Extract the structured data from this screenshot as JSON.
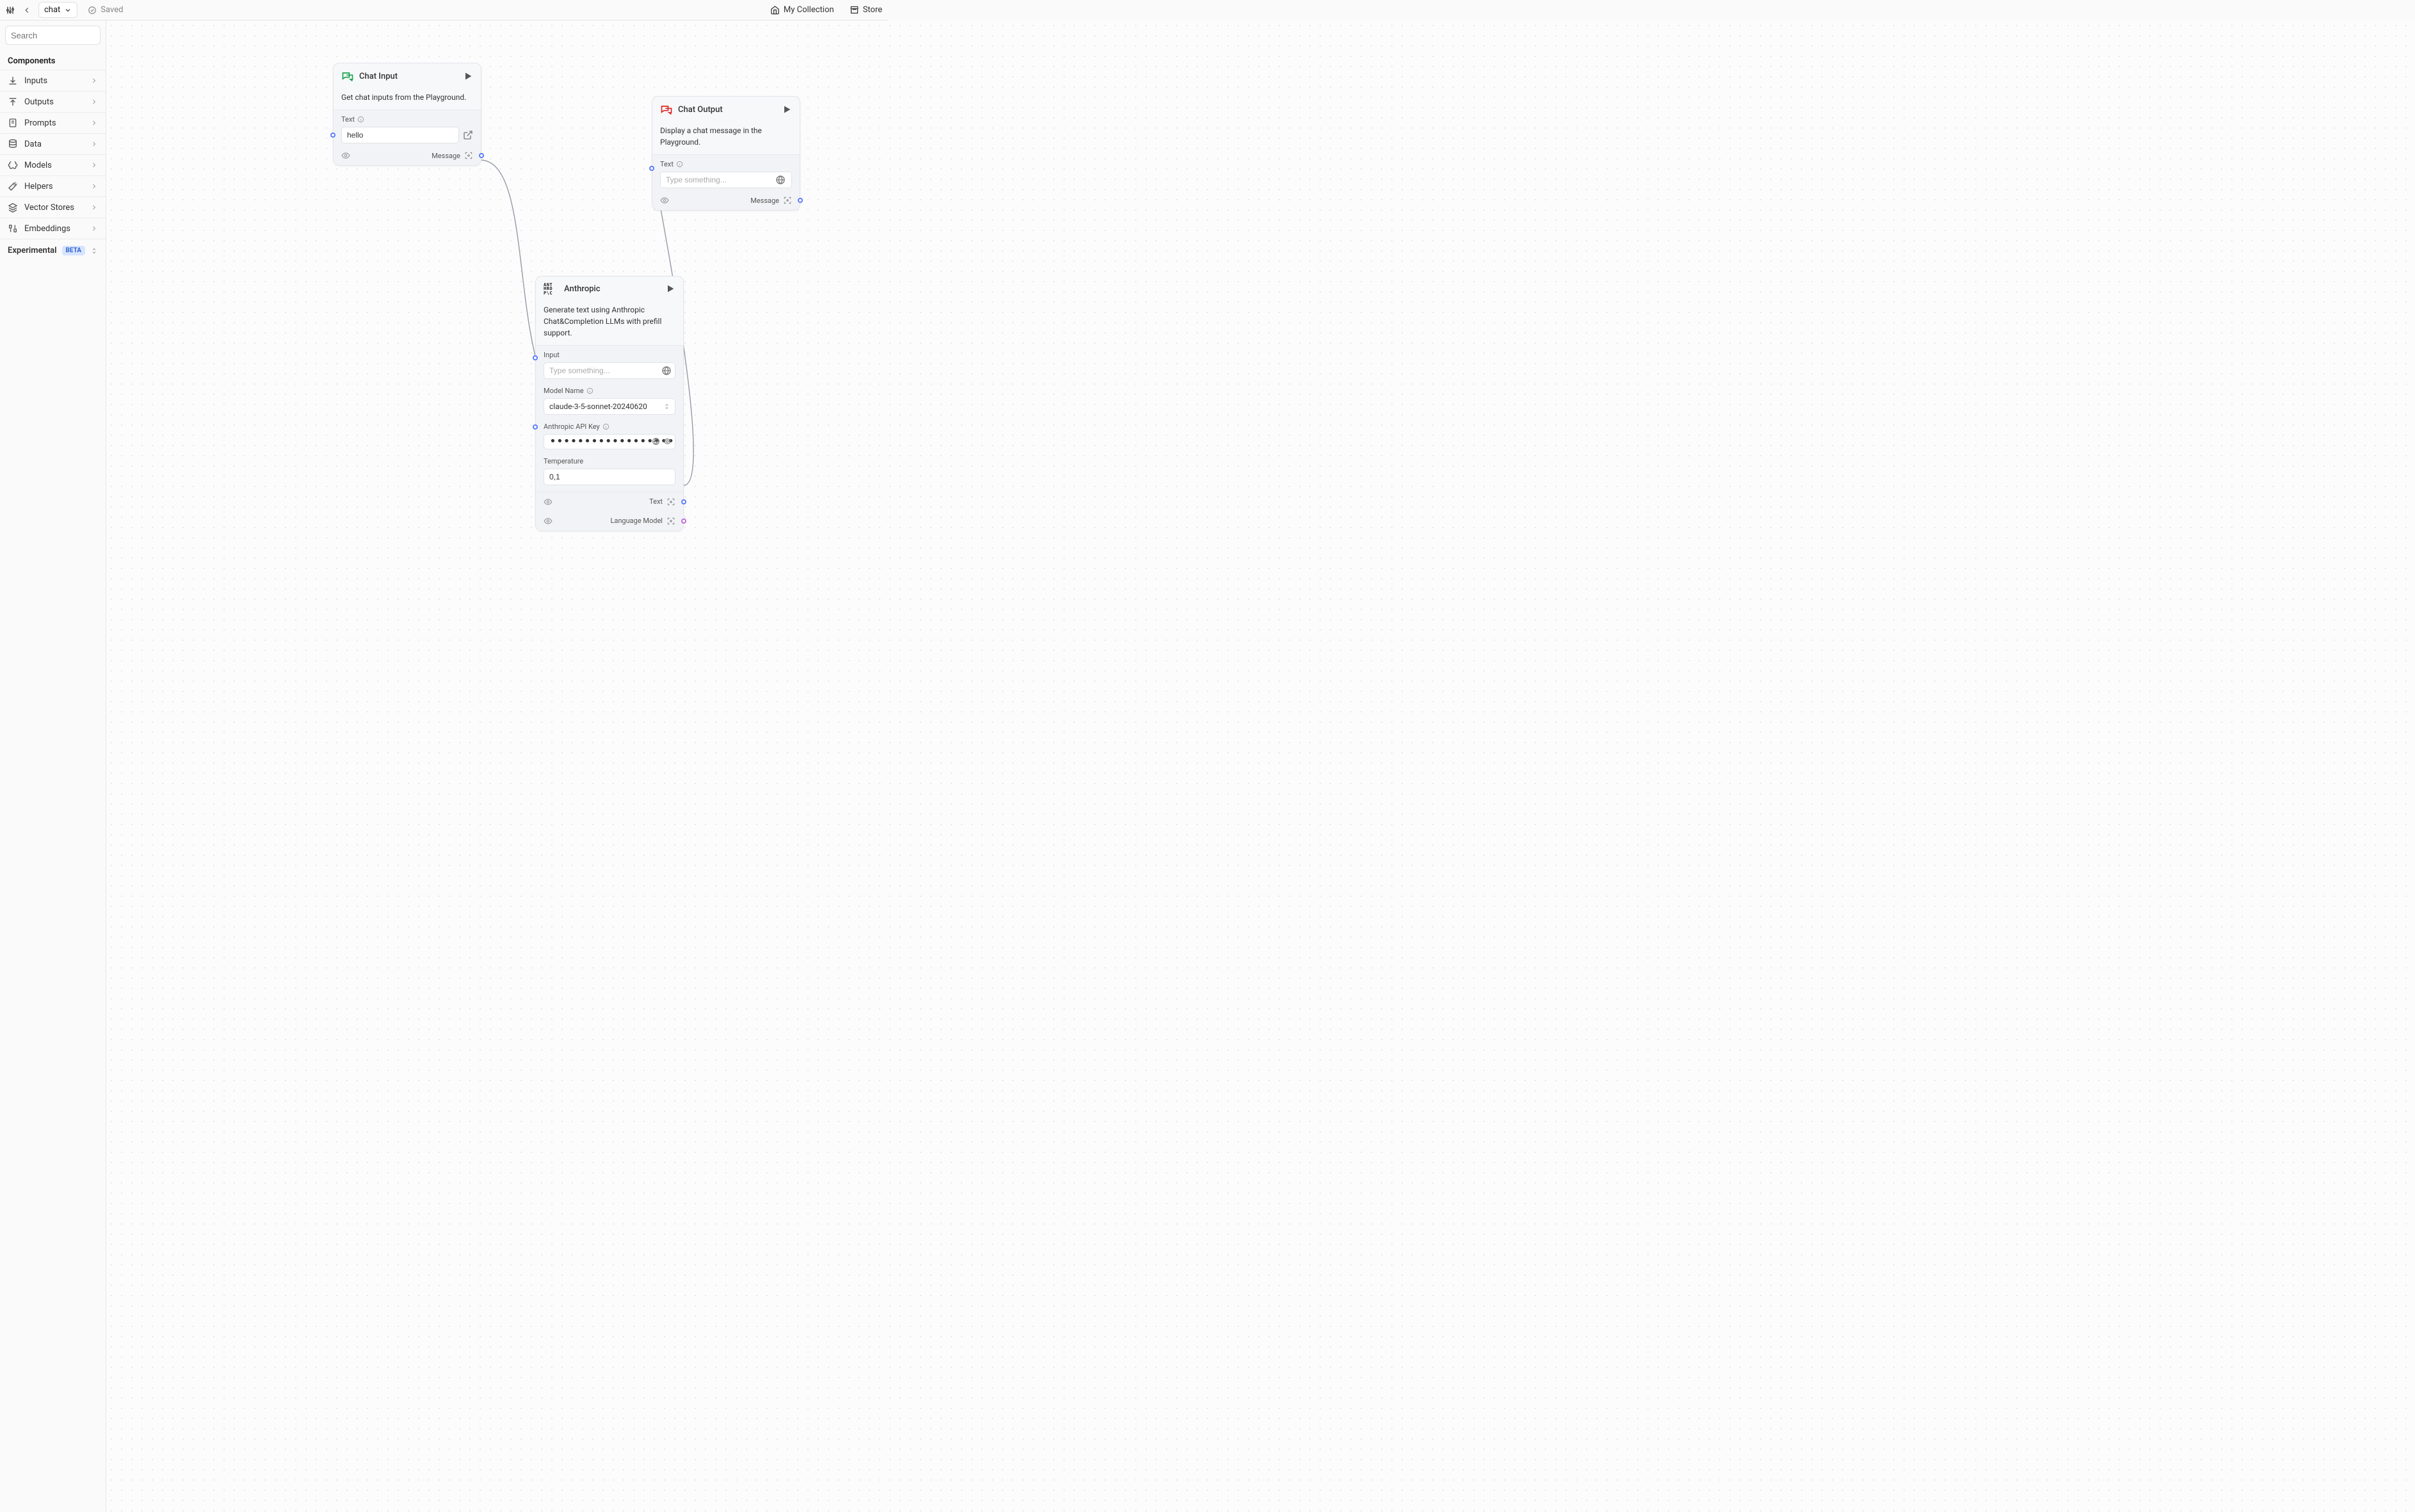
{
  "topbar": {
    "project_name": "chat",
    "saved_label": "Saved",
    "links": {
      "collection": "My Collection",
      "store": "Store"
    }
  },
  "sidebar": {
    "search_placeholder": "Search",
    "section_title": "Components",
    "items": [
      {
        "label": "Inputs",
        "icon": "download"
      },
      {
        "label": "Outputs",
        "icon": "upload"
      },
      {
        "label": "Prompts",
        "icon": "file"
      },
      {
        "label": "Data",
        "icon": "database"
      },
      {
        "label": "Models",
        "icon": "brain"
      },
      {
        "label": "Helpers",
        "icon": "wand"
      },
      {
        "label": "Vector Stores",
        "icon": "layers"
      },
      {
        "label": "Embeddings",
        "icon": "binary"
      }
    ],
    "experimental_label": "Experimental",
    "beta_label": "BETA"
  },
  "nodes": {
    "chat_input": {
      "title": "Chat Input",
      "description": "Get chat inputs from the Playground.",
      "text_label": "Text",
      "text_value": "hello",
      "output_label": "Message"
    },
    "chat_output": {
      "title": "Chat Output",
      "description": "Display a chat message in the Playground.",
      "text_label": "Text",
      "text_placeholder": "Type something...",
      "output_label": "Message"
    },
    "anthropic": {
      "title": "Anthropic",
      "description": "Generate text using Anthropic Chat&Completion LLMs with prefill support.",
      "input_label": "Input",
      "input_placeholder": "Type something...",
      "model_label": "Model Name",
      "model_value": "claude-3-5-sonnet-20240620",
      "apikey_label": "Anthropic API Key",
      "apikey_mask": "••••••••••••••••••••••••••••••••••••••••••••••••",
      "temp_label": "Temperature",
      "temp_value": "0,1",
      "output1_label": "Text",
      "output2_label": "Language Model"
    }
  }
}
